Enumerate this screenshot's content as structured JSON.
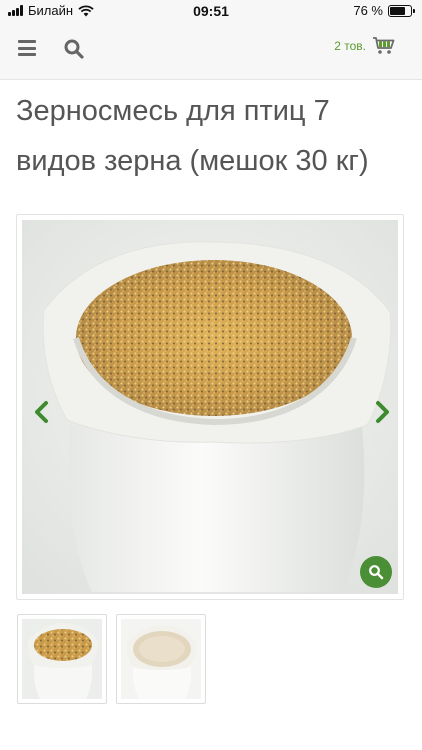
{
  "status_bar": {
    "carrier": "Билайн",
    "time": "09:51",
    "battery_percent": "76 %",
    "battery_level": 0.76
  },
  "header": {
    "menu_icon": "hamburger-menu-icon",
    "search_icon": "search-icon",
    "cart_count": "2 тов.",
    "cart_icon": "shopping-cart-icon",
    "accent_color": "#5c9c2e"
  },
  "product": {
    "title": "Зерносмесь для птиц 7 видов зерна (мешок 30 кг)"
  },
  "gallery": {
    "prev_icon": "chevron-left-icon",
    "next_icon": "chevron-right-icon",
    "zoom_icon": "zoom-icon",
    "zoom_button_color": "#4a8f35",
    "thumbnails_count": 2
  }
}
